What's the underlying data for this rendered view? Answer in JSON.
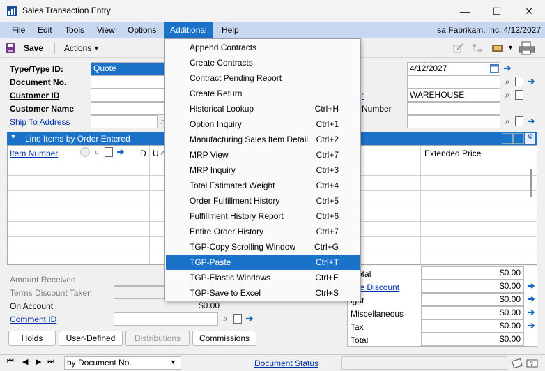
{
  "window": {
    "title": "Sales Transaction Entry",
    "minimize": "—",
    "maximize": "☐",
    "close": "✕"
  },
  "menubar": {
    "items": [
      "File",
      "Edit",
      "Tools",
      "View",
      "Options",
      "Additional",
      "Help"
    ],
    "active": "Additional",
    "context": "sa  Fabrikam, Inc.  4/12/2027"
  },
  "toolbar": {
    "save_label": "Save",
    "actions_label": "Actions"
  },
  "form": {
    "type_id_label": "Type/Type ID:",
    "type_id_value": "Quote",
    "document_no_label": "Document No.",
    "customer_id_label": "Customer ID",
    "customer_name_label": "Customer Name",
    "ship_to_label": "Ship To Address",
    "date_value": "4/12/2027",
    "site_value": "WAREHOUSE",
    "number_label_partial": "Number"
  },
  "grid": {
    "title": "Line Items by Order Entered",
    "col_item_number": "Item Number",
    "col_d": "D",
    "col_u": "U o",
    "col_extended_price": "Extended Price"
  },
  "dropdown": {
    "items": [
      {
        "label": "Append Contracts",
        "shortcut": ""
      },
      {
        "label": "Create Contracts",
        "shortcut": ""
      },
      {
        "label": "Contract Pending Report",
        "shortcut": ""
      },
      {
        "label": "Create Return",
        "shortcut": ""
      },
      {
        "label": "Historical Lookup",
        "shortcut": "Ctrl+H"
      },
      {
        "label": "Option Inquiry",
        "shortcut": "Ctrl+1"
      },
      {
        "label": "Manufacturing Sales Item Detail",
        "shortcut": "Ctrl+2"
      },
      {
        "label": "MRP View",
        "shortcut": "Ctrl+7"
      },
      {
        "label": "MRP Inquiry",
        "shortcut": "Ctrl+3"
      },
      {
        "label": "Total Estimated Weight",
        "shortcut": "Ctrl+4"
      },
      {
        "label": "Order Fulfillment History",
        "shortcut": "Ctrl+5"
      },
      {
        "label": "Fulfillment History Report",
        "shortcut": "Ctrl+6"
      },
      {
        "label": "Entire Order History",
        "shortcut": "Ctrl+7"
      },
      {
        "label": "TGP-Copy Scrolling Window",
        "shortcut": "Ctrl+G"
      },
      {
        "label": "TGP-Paste",
        "shortcut": "Ctrl+T"
      },
      {
        "label": "TGP-Elastic Windows",
        "shortcut": "Ctrl+E"
      },
      {
        "label": "TGP-Save to Excel",
        "shortcut": "Ctrl+S"
      }
    ],
    "highlighted": "TGP-Paste"
  },
  "bottom_left": {
    "amount_received_label": "Amount Received",
    "terms_discount_label": "Terms Discount Taken",
    "on_account_label": "On Account",
    "on_account_value": "$0.00",
    "comment_id_label": "Comment ID"
  },
  "totals": {
    "rows": [
      {
        "label": "btotal",
        "value": "$0.00"
      },
      {
        "label": "ade Discount",
        "value": "$0.00"
      },
      {
        "label": "ight",
        "value": "$0.00"
      },
      {
        "label": "Miscellaneous",
        "value": "$0.00"
      },
      {
        "label": "Tax",
        "value": "$0.00"
      },
      {
        "label": "Total",
        "value": "$0.00"
      }
    ]
  },
  "buttons": {
    "holds": "Holds",
    "user_defined": "User-Defined",
    "distributions": "Distributions",
    "commissions": "Commissions"
  },
  "statusbar": {
    "sort_value": "by Document No.",
    "document_status_label": "Document Status"
  },
  "colors": {
    "accent": "#1a73c8",
    "menubar": "#c7d7f0"
  }
}
